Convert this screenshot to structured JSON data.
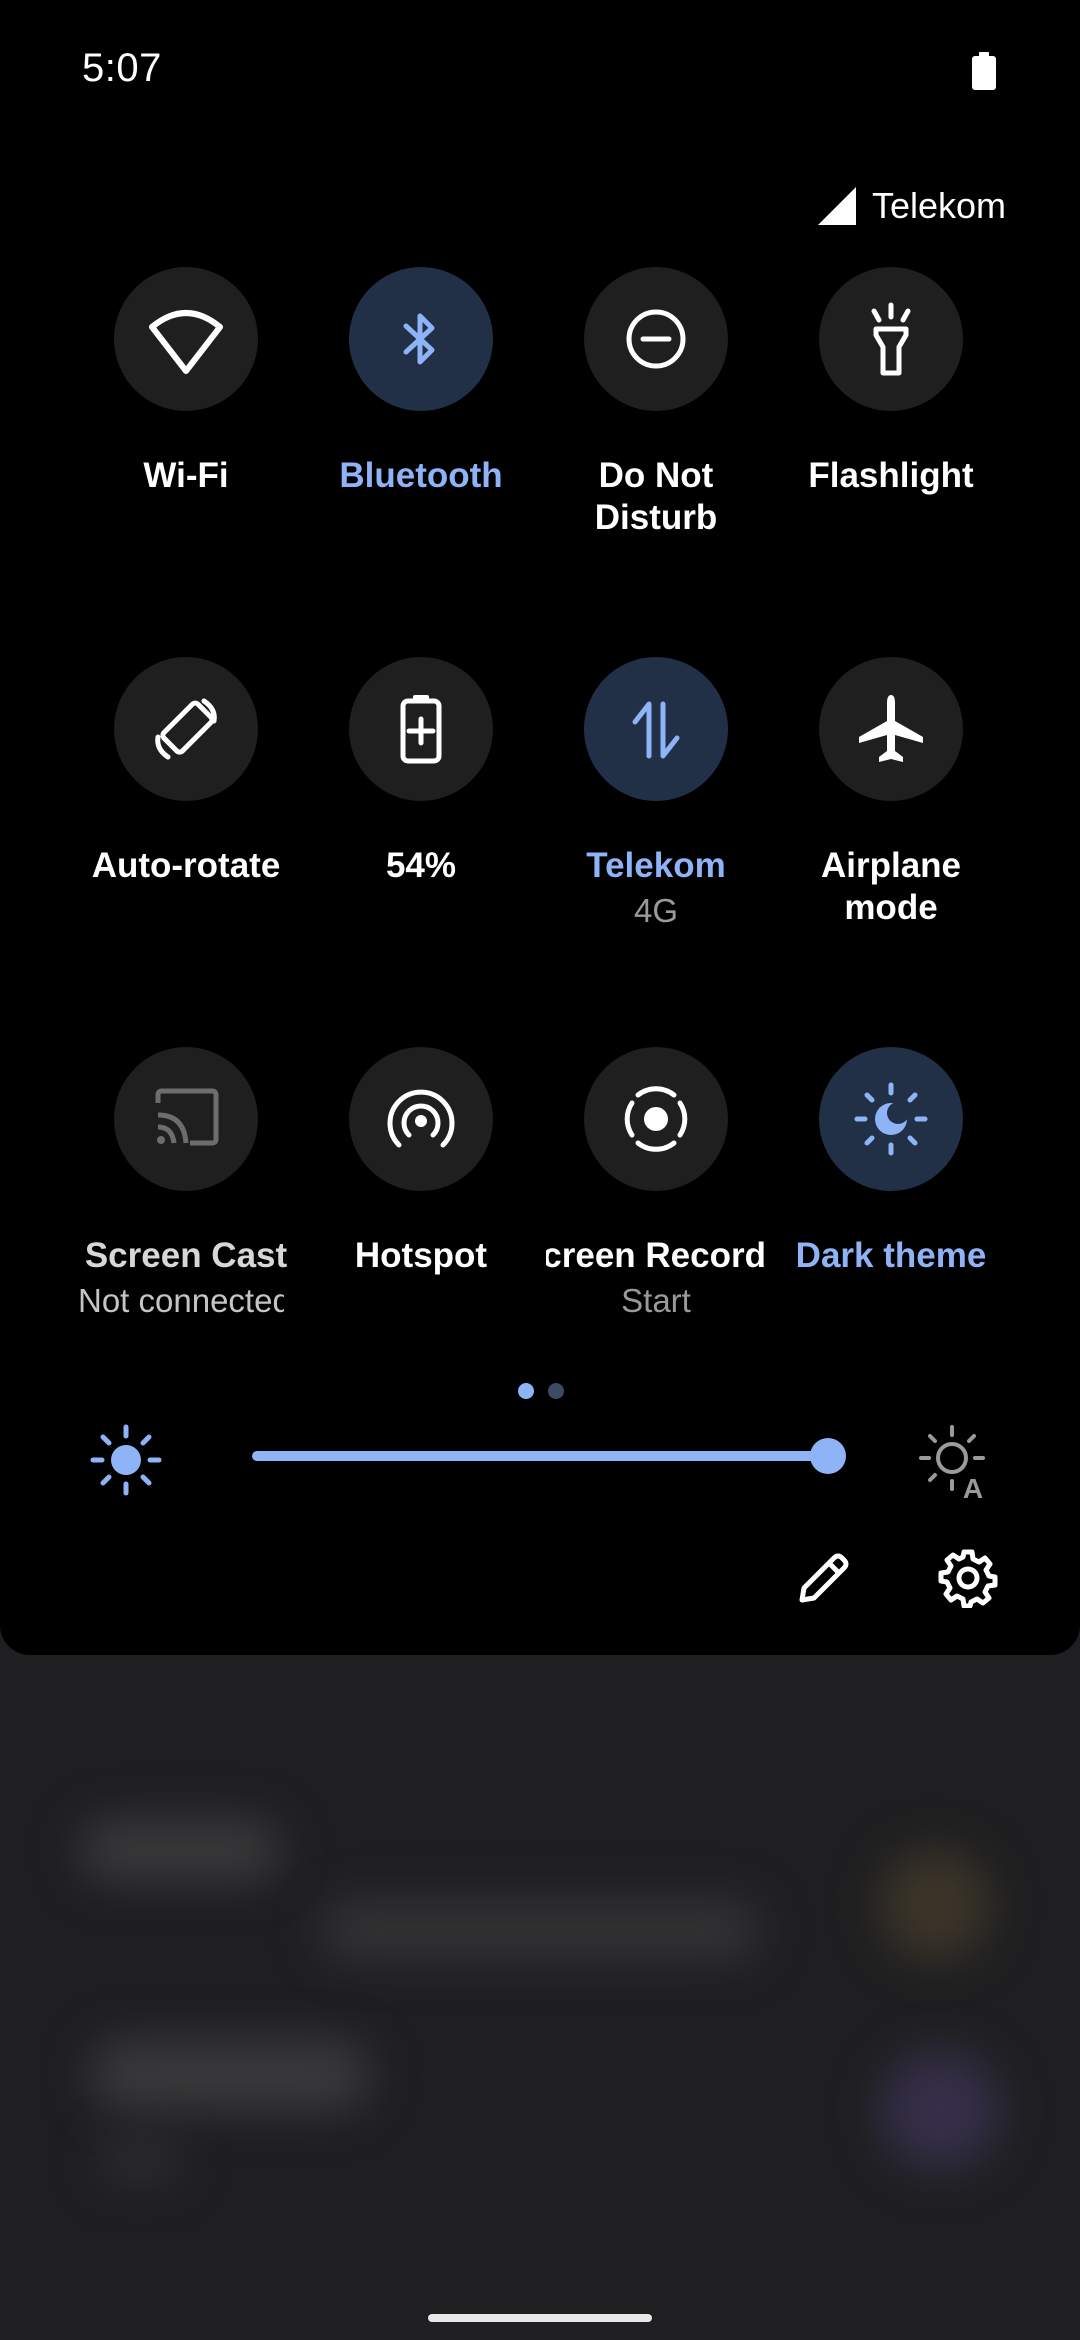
{
  "status_bar": {
    "time": "5:07",
    "battery_icon": "battery-icon"
  },
  "carrier": {
    "name": "Telekom",
    "icon": "signal-icon"
  },
  "tiles": [
    {
      "id": "wifi",
      "label": "Wi-Fi",
      "icon": "wifi-icon",
      "active": false
    },
    {
      "id": "bluetooth",
      "label": "Bluetooth",
      "icon": "bluetooth-icon",
      "active": true
    },
    {
      "id": "dnd",
      "label_line1": "Do Not",
      "label_line2": "Disturb",
      "icon": "do-not-disturb-icon",
      "active": false
    },
    {
      "id": "flashlight",
      "label": "Flashlight",
      "icon": "flashlight-icon",
      "active": false
    },
    {
      "id": "autorotate",
      "label": "Auto-rotate",
      "icon": "auto-rotate-icon",
      "active": false
    },
    {
      "id": "battery",
      "label": "54%",
      "icon": "battery-saver-icon",
      "active": false
    },
    {
      "id": "mobile-data",
      "label": "Telekom",
      "sub": "4G",
      "icon": "mobile-data-icon",
      "active": true
    },
    {
      "id": "airplane",
      "label_line1": "Airplane",
      "label_line2": "mode",
      "icon": "airplane-icon",
      "active": false
    },
    {
      "id": "screen-cast",
      "label": "Screen Cast",
      "sub": "Not connected",
      "icon": "cast-icon",
      "active": false,
      "disabled": true
    },
    {
      "id": "hotspot",
      "label": "Hotspot",
      "icon": "hotspot-icon",
      "active": false
    },
    {
      "id": "screen-record",
      "label": "Screen Record",
      "sub": "Start",
      "icon": "screen-record-icon",
      "active": false
    },
    {
      "id": "dark-theme",
      "label": "Dark theme",
      "icon": "dark-theme-icon",
      "active": true
    }
  ],
  "pager": {
    "pages": 2,
    "current": 1
  },
  "brightness": {
    "level_percent": 100,
    "icon": "brightness-icon",
    "auto_icon": "auto-brightness-icon"
  },
  "footer": {
    "edit_icon": "edit-icon",
    "settings_icon": "settings-icon"
  },
  "colors": {
    "accent": "#8eb3f7",
    "active_tile_bg": "#223047",
    "tile_bg": "#1f1f1f",
    "panel_bg": "#000000"
  }
}
